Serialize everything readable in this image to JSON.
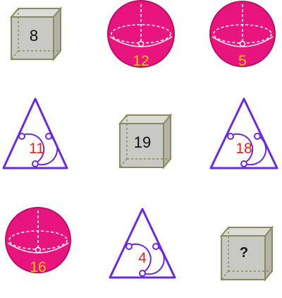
{
  "colors": {
    "cube_face": "#c9c9c4",
    "cube_side": "#b3b3ac",
    "cube_top": "#dcdcd7",
    "cube_stroke": "#8a8a60",
    "cube_dash": "#8a8a60",
    "sphere_fill": "#e8157e",
    "sphere_stroke": "#b80f63",
    "sphere_lines": "#ffffff",
    "sphere_number": "#f2c200",
    "triangle_stroke": "#6a2cd6",
    "triangle_number": "#e0241b",
    "cube_number": "#111111"
  },
  "puzzle": {
    "cells": [
      {
        "shape": "cube",
        "value": "8"
      },
      {
        "shape": "sphere",
        "value": "12"
      },
      {
        "shape": "sphere",
        "value": "5"
      },
      {
        "shape": "triangle",
        "value": "11"
      },
      {
        "shape": "cube",
        "value": "19"
      },
      {
        "shape": "triangle",
        "value": "18"
      },
      {
        "shape": "sphere",
        "value": "16"
      },
      {
        "shape": "triangle",
        "value": "4"
      },
      {
        "shape": "cube",
        "value": "?"
      }
    ]
  }
}
